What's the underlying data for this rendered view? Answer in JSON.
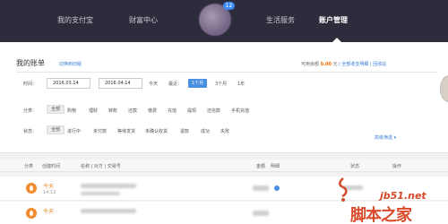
{
  "nav": {
    "items": [
      "我的支付宝",
      "财富中心",
      "生活服务",
      "账户管理"
    ],
    "badge": "12",
    "active_index": 3
  },
  "header": {
    "title": "我的账单",
    "switch_link": "切换到旧版",
    "balance_label": "可用余额",
    "balance_amount": "0.00",
    "balance_unit": "元",
    "balance_links": "| 全部收支明细 | 回收站"
  },
  "filters": {
    "time_label": "时间：",
    "start_date": "2016.03.14",
    "end_date": "2016.04.14",
    "today": "今天",
    "recent_label": "最近：",
    "recent_options": [
      "1个月",
      "3个月",
      "1年"
    ],
    "category_label": "分类：",
    "categories": [
      "全部",
      "购物",
      "理财",
      "转账",
      "还款",
      "缴费",
      "充值",
      "提现",
      "还信款",
      "手机充值"
    ],
    "status_label": "状态：",
    "statuses": [
      "全部",
      "进行中",
      "未付款",
      "等待发货",
      "未确认收货",
      "退款",
      "成功",
      "失败"
    ],
    "advanced": "高级筛选"
  },
  "table": {
    "headers": [
      "分类",
      "创建时间",
      "名称 | 对方 | 交易号",
      "金额",
      "明细",
      "状态",
      "操作"
    ],
    "rows": [
      {
        "day": "今天",
        "time": "14:12"
      },
      {
        "day": "今天",
        "time": ""
      }
    ]
  },
  "watermark": {
    "url": "jb51.net",
    "text": "脚本之家"
  },
  "colors": {
    "nav_bg": "#2c2c3d",
    "accent": "#4a8fe0",
    "orange": "#f28b2d"
  }
}
